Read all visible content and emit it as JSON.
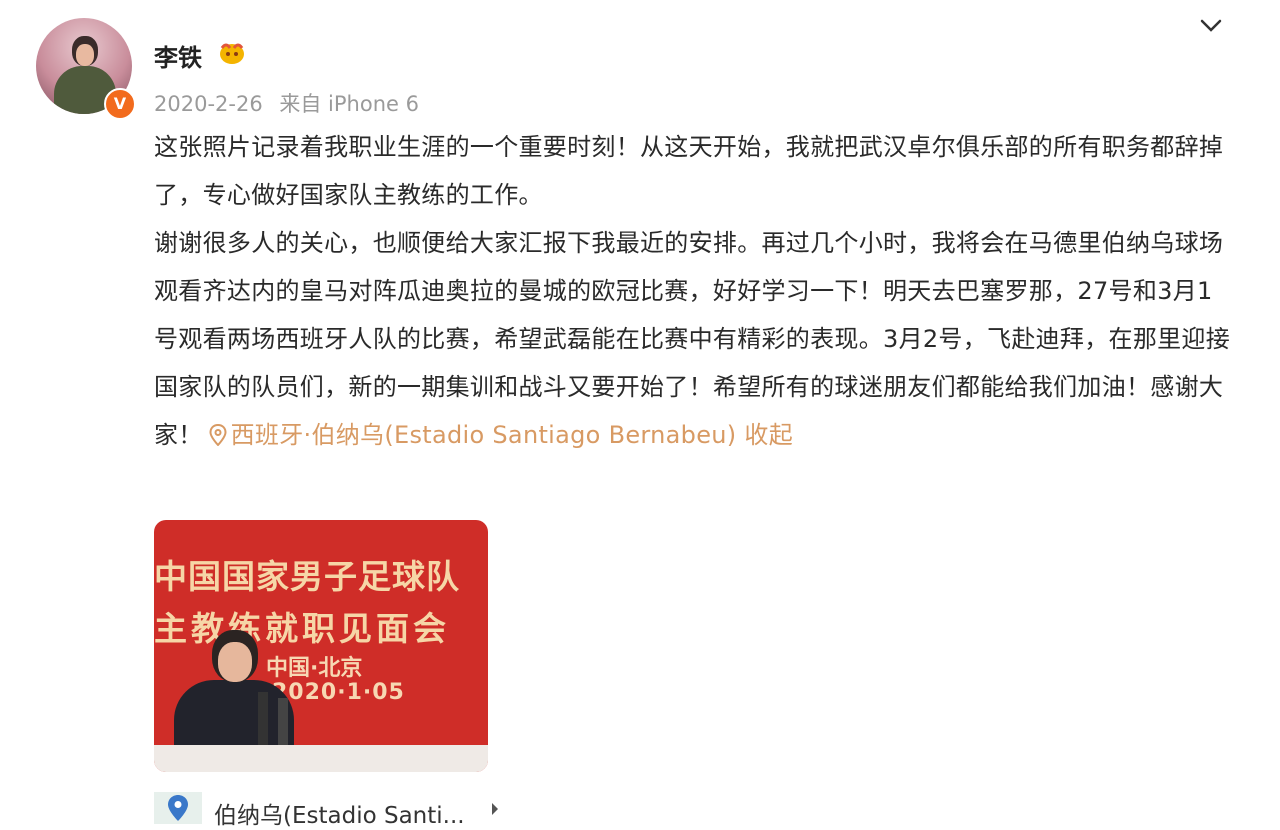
{
  "user": {
    "name": "李铁",
    "verified_icon": "verified-badge-icon",
    "badge_icon": "fan-badge-icon"
  },
  "post": {
    "date": "2020-2-26",
    "source": "来自 iPhone 6",
    "paragraph1": "这张照片记录着我职业生涯的一个重要时刻！从这天开始，我就把武汉卓尔俱乐部的所有职务都辞掉了，专心做好国家队主教练的工作。",
    "paragraph2": "谢谢很多人的关心，也顺便给大家汇报下我最近的安排。再过几个小时，我将会在马德里伯纳乌球场观看齐达内的皇马对阵瓜迪奥拉的曼城的欧冠比赛，好好学习一下！明天去巴塞罗那，27号和3月1号观看两场西班牙人队的比赛，希望武磊能在比赛中有精彩的表现。3月2号，飞赴迪拜，在那里迎接国家队的队员们，新的一期集训和战斗又要开始了！希望所有的球迷朋友们都能给我们加油！感谢大家！",
    "location_link": "西班牙·伯纳乌(Estadio Santiago Bernabeu)",
    "collapse_label": "收起"
  },
  "photo": {
    "line1": "中国国家男子足球队",
    "line2": "主教练就职见面会",
    "place": "中国·北京",
    "date": "2020·1·05"
  },
  "location_bar": {
    "text": "伯纳乌(Estadio Santi..."
  },
  "colors": {
    "link": "#d89a63",
    "meta": "#9a9a9a",
    "photo_bg": "#cf2d28"
  }
}
